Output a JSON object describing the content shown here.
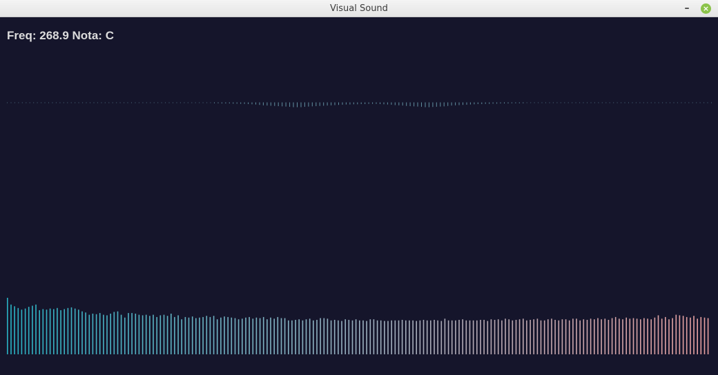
{
  "window": {
    "title": "Visual Sound",
    "minimize_glyph": "–",
    "close_glyph": "×",
    "close_color": "#8bc34a"
  },
  "readout": {
    "freq_label": "Freq:",
    "freq_value": "268.9",
    "note_label": "Nota:",
    "note_value": "C"
  },
  "colors": {
    "background": "#15152b",
    "waveform": "#6fa3b5",
    "spectrum_start": "#2ab3c4",
    "spectrum_mid": "#9bb0c0",
    "spectrum_end": "#e8a0a0"
  },
  "waveform": {
    "samples": 185,
    "amplitudes": [
      0,
      0,
      0,
      0,
      0,
      0,
      0,
      0,
      0,
      0,
      0,
      0,
      0,
      0,
      0,
      0,
      0,
      0,
      0,
      0,
      0,
      0,
      0,
      0,
      0,
      0,
      0,
      0,
      0,
      0,
      0,
      0,
      0,
      0,
      0,
      0,
      0,
      0,
      0,
      0,
      0,
      0,
      0,
      0,
      0,
      0,
      0,
      0,
      0,
      0,
      0,
      0,
      0,
      0,
      0,
      0.05,
      0.05,
      0.1,
      0.1,
      0.1,
      0.15,
      0.15,
      0.2,
      0.2,
      0.25,
      0.3,
      0.35,
      0.45,
      0.55,
      0.6,
      0.65,
      0.7,
      0.75,
      0.8,
      0.85,
      0.9,
      1,
      1,
      1,
      0.9,
      0.85,
      0.8,
      0.75,
      0.7,
      0.65,
      0.6,
      0.55,
      0.5,
      0.45,
      0.4,
      0.35,
      0.35,
      0.3,
      0.3,
      0.25,
      0.25,
      0.2,
      0.2,
      0.2,
      0.25,
      0.3,
      0.35,
      0.4,
      0.5,
      0.55,
      0.6,
      0.7,
      0.75,
      0.8,
      0.85,
      0.9,
      1,
      1,
      0.95,
      0.9,
      0.85,
      0.8,
      0.7,
      0.6,
      0.55,
      0.5,
      0.45,
      0.4,
      0.35,
      0.3,
      0.25,
      0.25,
      0.2,
      0.2,
      0.15,
      0.15,
      0.1,
      0.1,
      0.1,
      0.05,
      0.05,
      0.05,
      0.05,
      0,
      0,
      0,
      0,
      0,
      0,
      0,
      0,
      0,
      0,
      0,
      0,
      0,
      0,
      0,
      0,
      0,
      0,
      0,
      0,
      0,
      0,
      0,
      0,
      0,
      0,
      0,
      0,
      0,
      0,
      0,
      0,
      0,
      0,
      0,
      0,
      0,
      0,
      0,
      0,
      0,
      0,
      0,
      0,
      0,
      0,
      0,
      0,
      0,
      0
    ]
  },
  "spectrum": {
    "bars": 200,
    "levels": [
      1.0,
      0.88,
      0.85,
      0.82,
      0.79,
      0.81,
      0.84,
      0.86,
      0.88,
      0.78,
      0.8,
      0.79,
      0.81,
      0.8,
      0.82,
      0.78,
      0.8,
      0.82,
      0.83,
      0.81,
      0.79,
      0.76,
      0.74,
      0.7,
      0.72,
      0.71,
      0.73,
      0.7,
      0.69,
      0.72,
      0.75,
      0.76,
      0.7,
      0.65,
      0.73,
      0.73,
      0.72,
      0.7,
      0.69,
      0.7,
      0.68,
      0.7,
      0.66,
      0.69,
      0.7,
      0.68,
      0.72,
      0.66,
      0.69,
      0.62,
      0.66,
      0.65,
      0.67,
      0.64,
      0.65,
      0.66,
      0.68,
      0.66,
      0.68,
      0.62,
      0.65,
      0.67,
      0.66,
      0.65,
      0.64,
      0.62,
      0.63,
      0.65,
      0.66,
      0.63,
      0.65,
      0.64,
      0.66,
      0.62,
      0.65,
      0.63,
      0.66,
      0.64,
      0.64,
      0.6,
      0.6,
      0.61,
      0.62,
      0.6,
      0.62,
      0.63,
      0.6,
      0.61,
      0.64,
      0.64,
      0.63,
      0.6,
      0.61,
      0.6,
      0.59,
      0.62,
      0.61,
      0.6,
      0.62,
      0.6,
      0.6,
      0.59,
      0.62,
      0.62,
      0.6,
      0.6,
      0.59,
      0.59,
      0.6,
      0.6,
      0.6,
      0.61,
      0.6,
      0.6,
      0.6,
      0.59,
      0.6,
      0.61,
      0.6,
      0.6,
      0.61,
      0.6,
      0.59,
      0.63,
      0.6,
      0.6,
      0.6,
      0.61,
      0.62,
      0.6,
      0.6,
      0.6,
      0.6,
      0.61,
      0.61,
      0.59,
      0.62,
      0.61,
      0.62,
      0.6,
      0.63,
      0.62,
      0.6,
      0.61,
      0.62,
      0.63,
      0.6,
      0.61,
      0.62,
      0.63,
      0.6,
      0.6,
      0.62,
      0.63,
      0.61,
      0.6,
      0.62,
      0.62,
      0.6,
      0.63,
      0.63,
      0.6,
      0.62,
      0.61,
      0.63,
      0.62,
      0.64,
      0.62,
      0.63,
      0.61,
      0.64,
      0.66,
      0.63,
      0.62,
      0.65,
      0.63,
      0.64,
      0.63,
      0.62,
      0.64,
      0.63,
      0.62,
      0.65,
      0.69,
      0.63,
      0.66,
      0.62,
      0.64,
      0.7,
      0.69,
      0.68,
      0.66,
      0.65,
      0.68,
      0.63,
      0.66,
      0.65,
      0.64
    ]
  }
}
